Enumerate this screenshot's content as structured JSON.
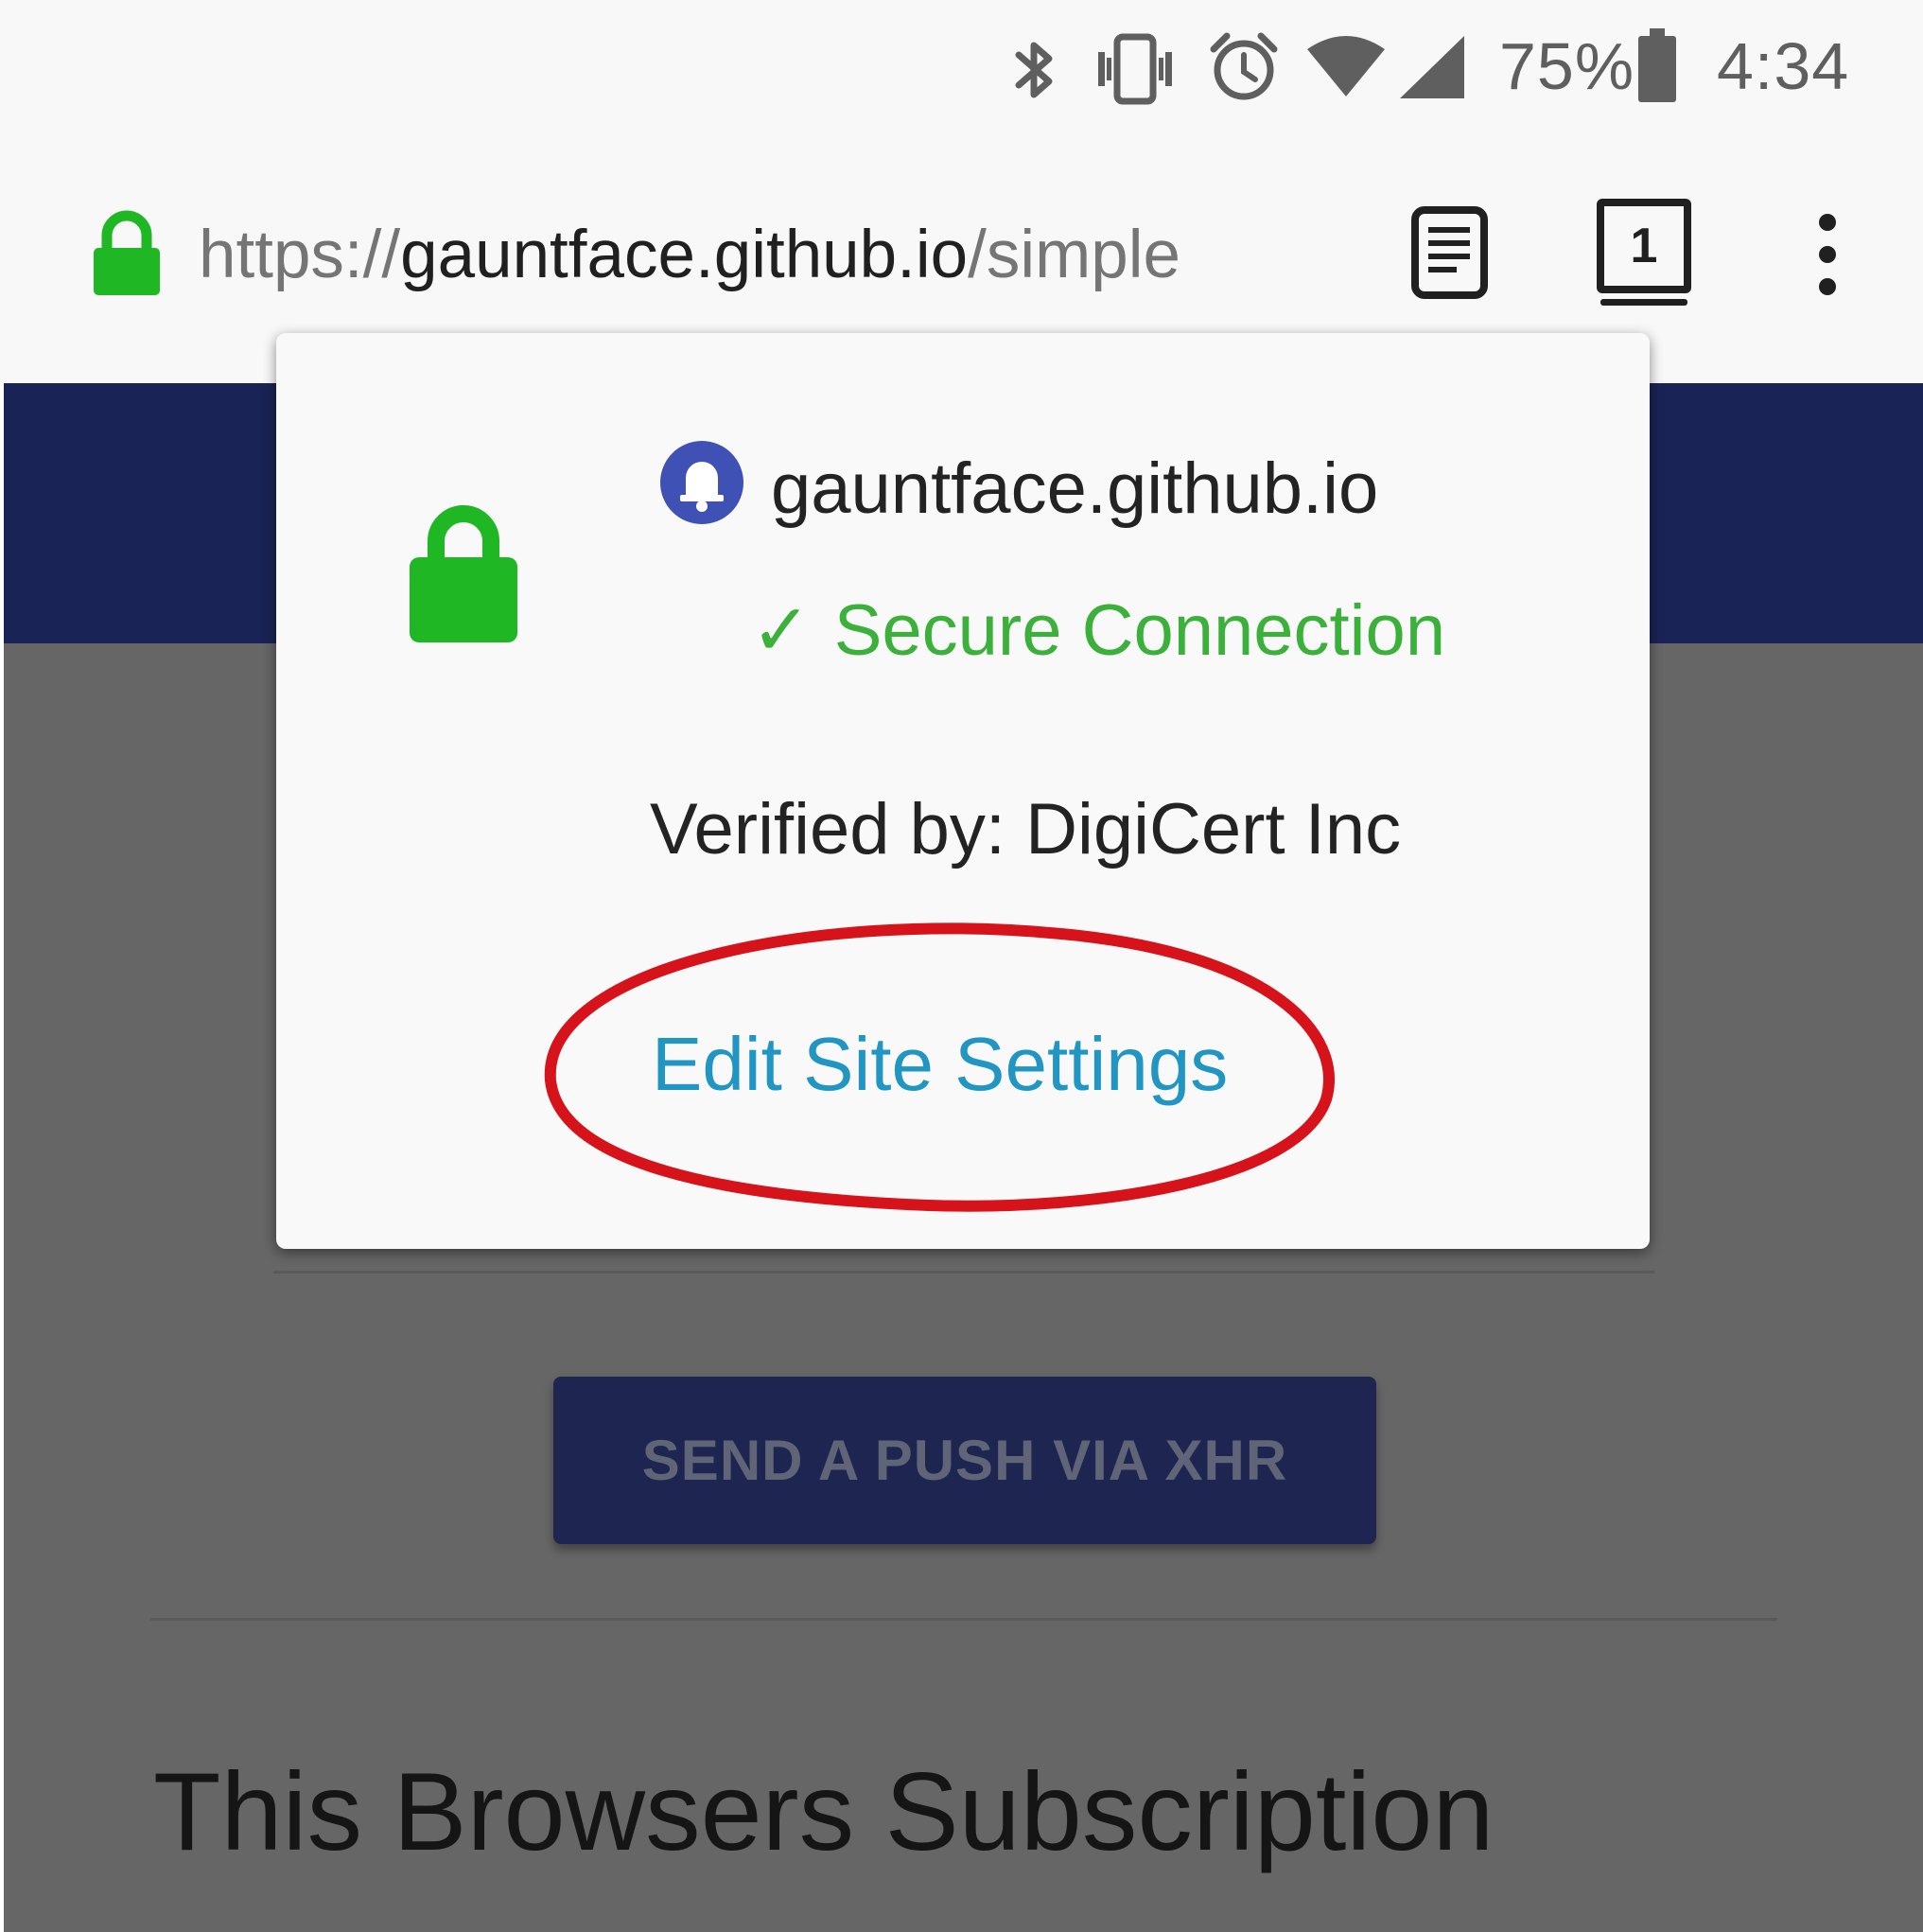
{
  "status_bar": {
    "battery_percent": "75%",
    "time": "4:34",
    "icons": [
      "bluetooth-icon",
      "vibrate-icon",
      "alarm-icon",
      "wifi-icon",
      "cell-signal-icon",
      "battery-icon"
    ]
  },
  "toolbar": {
    "url_scheme": "https://",
    "url_host": "gauntface.github.io",
    "url_path": "/simple",
    "tab_count": "1",
    "icons": [
      "lock-icon",
      "reader-mode-icon",
      "tabs-icon",
      "overflow-menu-icon"
    ]
  },
  "popup": {
    "site_name": "gauntface.github.io",
    "secure_label": "Secure Connection",
    "check_glyph": "✓",
    "verified_by": "Verified by: DigiCert Inc",
    "edit_settings_link": "Edit Site Settings"
  },
  "page": {
    "push_button_label": "SEND A PUSH VIA XHR",
    "heading": "This Browsers Subscription"
  },
  "colors": {
    "lock_green": "#1fb724",
    "secure_green": "#3bb03b",
    "link_blue": "#2196c3",
    "header_navy": "#1a2355",
    "annotation_red": "#d6131a",
    "notification_badge": "#3f51b5"
  }
}
